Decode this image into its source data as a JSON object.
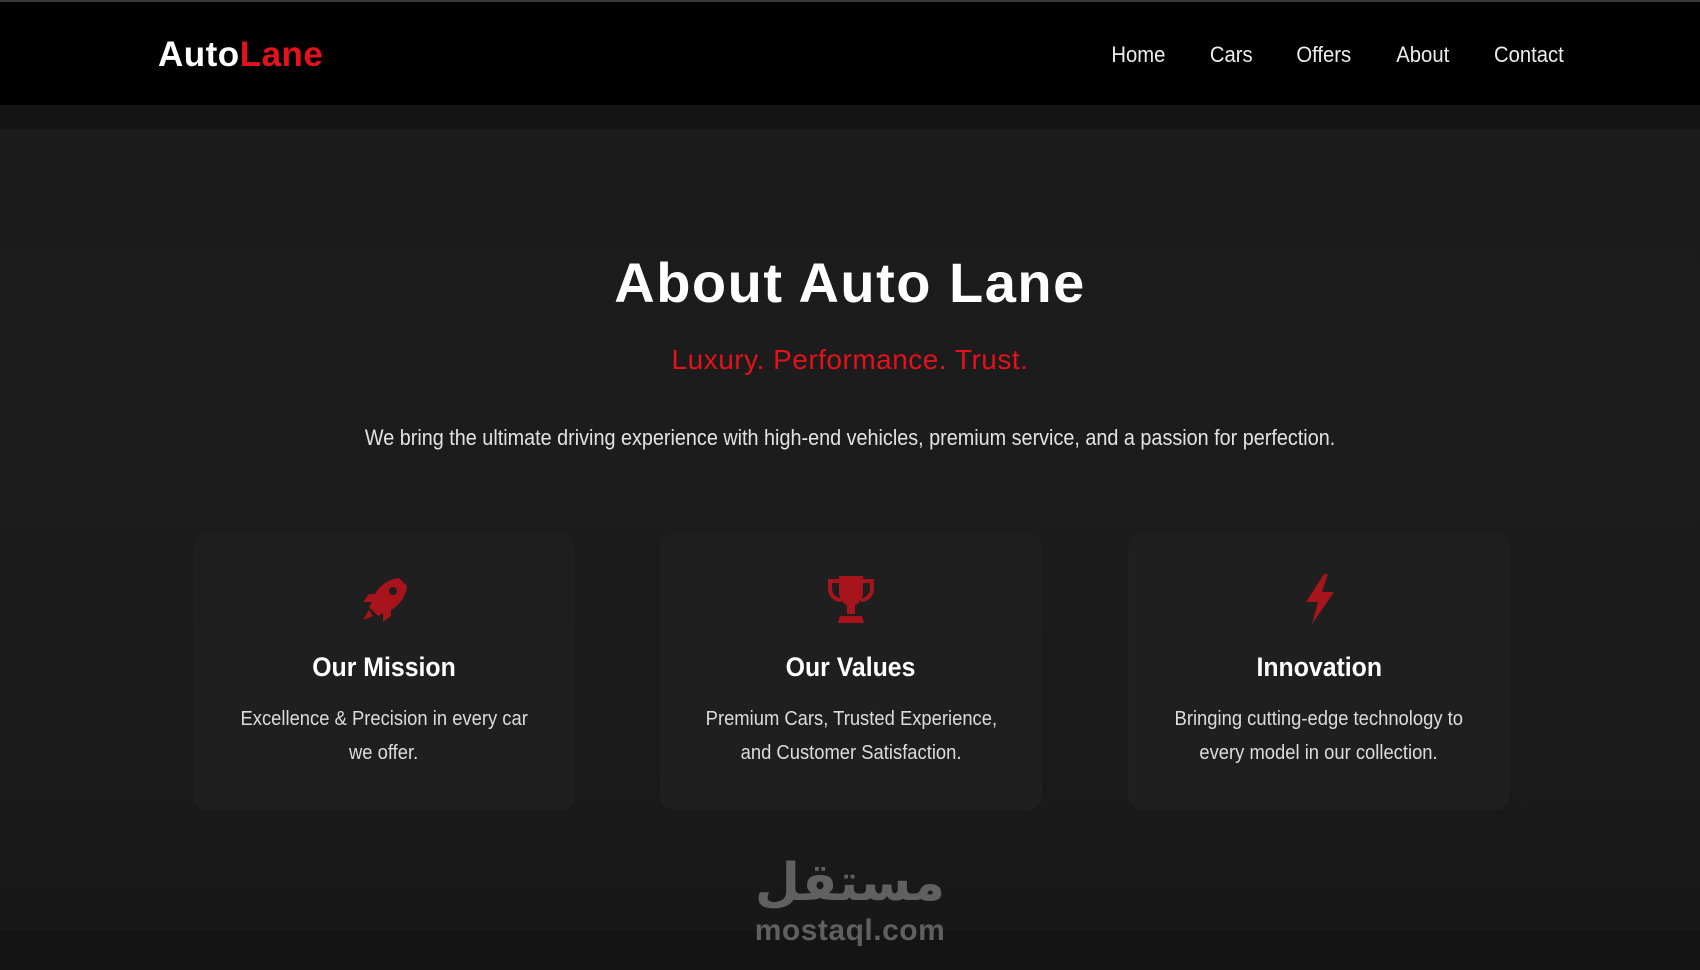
{
  "brand": {
    "logo_part1": "Auto",
    "logo_part2": "Lane",
    "accent_color": "#e3121c"
  },
  "nav": {
    "items": [
      {
        "label": "Home"
      },
      {
        "label": "Cars"
      },
      {
        "label": "Offers"
      },
      {
        "label": "About"
      },
      {
        "label": "Contact"
      }
    ]
  },
  "hero": {
    "title": "About Auto Lane",
    "tagline": "Luxury. Performance. Trust.",
    "lead": "We bring the ultimate driving experience with high-end vehicles, premium service, and a passion for perfection."
  },
  "cards": [
    {
      "icon": "rocket-icon",
      "title": "Our Mission",
      "line1": "Excellence & Precision in every car",
      "line2": "we offer."
    },
    {
      "icon": "trophy-icon",
      "title": "Our Values",
      "line1": "Premium Cars, Trusted Experience,",
      "line2": "and Customer Satisfaction."
    },
    {
      "icon": "bolt-icon",
      "title": "Innovation",
      "line1": "Bringing cutting-edge technology to",
      "line2": "every model in our collection."
    }
  ],
  "watermark": {
    "arabic": "مستقل",
    "latin": "mostaql.com"
  }
}
